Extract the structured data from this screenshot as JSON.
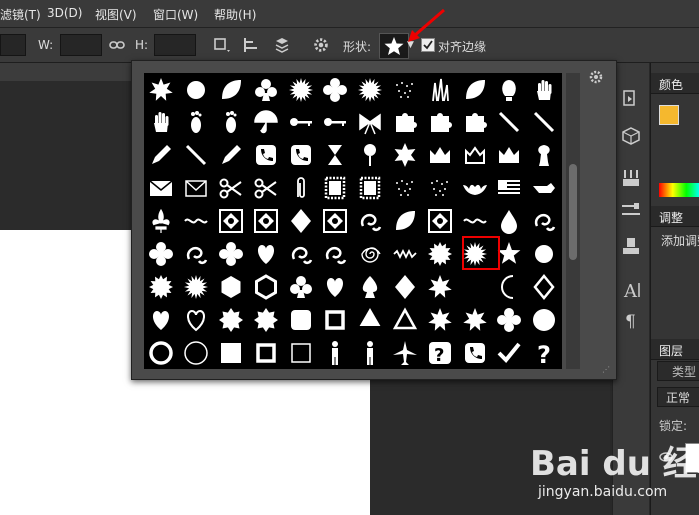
{
  "menubar": {
    "items": [
      "滤镜(T)",
      "3D(D)",
      "视图(V)",
      "窗口(W)",
      "帮助(H)"
    ]
  },
  "options_bar": {
    "w_label": "W:",
    "h_label": "H:",
    "shape_label": "形状:",
    "align_edges_label": "对齐边缘",
    "align_edges_checked": true
  },
  "right_panel": {
    "color_panel_title": "颜色",
    "adjust_panel_title": "调整",
    "adjust_add_text": "添加调整",
    "layers_panel_title": "图层",
    "layers_filter_placeholder": "类型",
    "blend_mode": "正常",
    "lock_label": "锁定:",
    "foreground_color": "#f5b82e"
  },
  "shape_picker": {
    "selected_shape": "5-point-star",
    "selected_row": 5,
    "selected_col": 10,
    "scroll_fraction": 0.45,
    "rows": 9,
    "cols": 12
  },
  "watermark": {
    "brand": "Bai du 经验",
    "url": "jingyan.baidu.com"
  }
}
